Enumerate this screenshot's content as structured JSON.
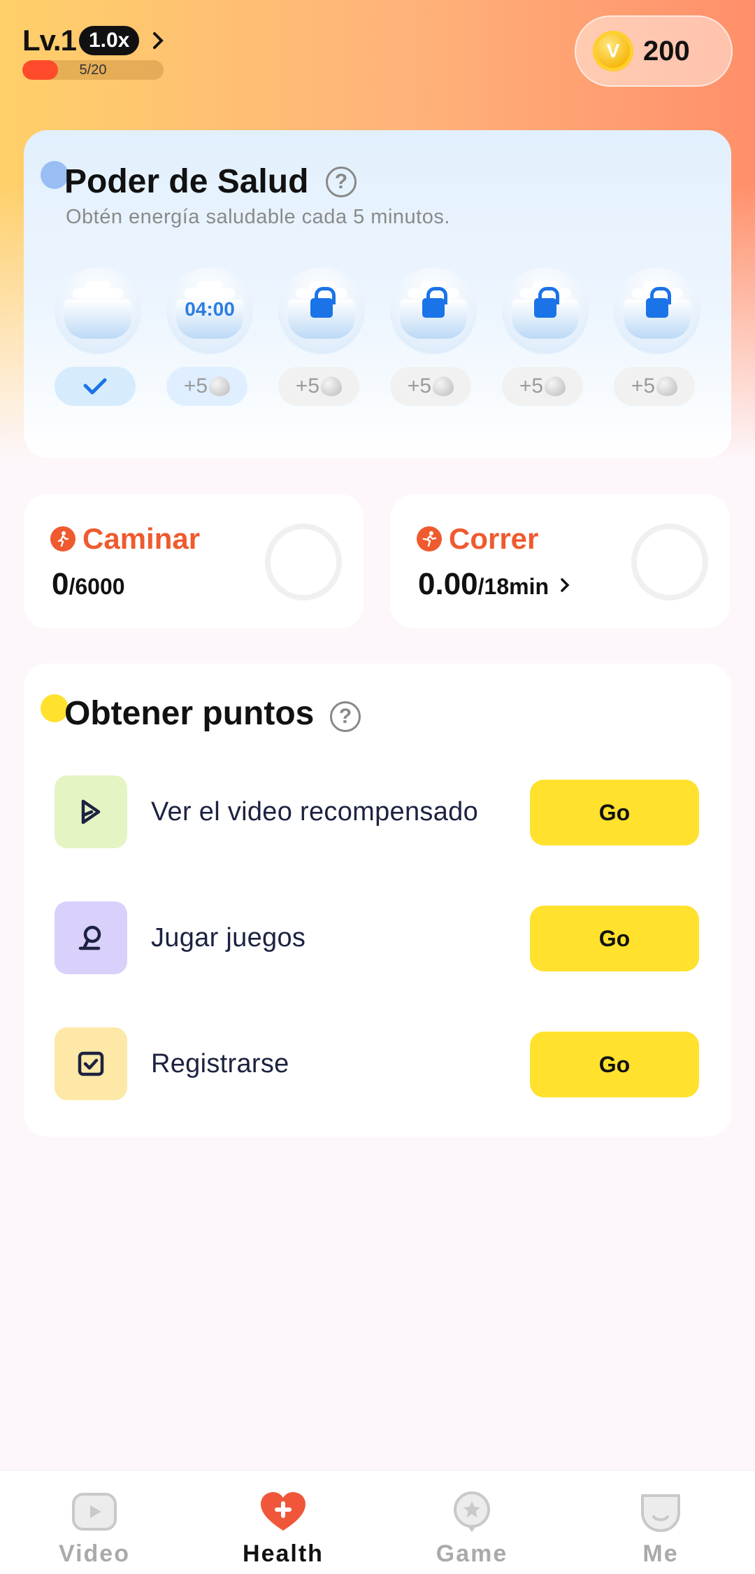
{
  "header": {
    "level": "Lv.1",
    "multiplier": "1.0x",
    "progress_text": "5/20",
    "progress_fraction": 0.25,
    "coins": "200",
    "coin_symbol": "V"
  },
  "health_power": {
    "title": "Poder de Salud",
    "help": "?",
    "subtitle": "Obtén energía saludable cada 5 minutos.",
    "slots": [
      {
        "state": "claimed",
        "icon": "check-icon"
      },
      {
        "state": "timer",
        "timer": "04:00",
        "reward": "+5"
      },
      {
        "state": "locked",
        "reward": "+5"
      },
      {
        "state": "locked",
        "reward": "+5"
      },
      {
        "state": "locked",
        "reward": "+5"
      },
      {
        "state": "locked",
        "reward": "+5"
      }
    ]
  },
  "walk": {
    "label": "Caminar",
    "value": "0",
    "target": "/6000"
  },
  "run": {
    "label": "Correr",
    "value": "0.00",
    "target": "/18min"
  },
  "points": {
    "title": "Obtener puntos",
    "help": "?",
    "tasks": [
      {
        "label": "Ver el video recompensado",
        "button": "Go"
      },
      {
        "label": "Jugar juegos",
        "button": "Go"
      },
      {
        "label": "Registrarse",
        "button": "Go"
      }
    ]
  },
  "nav": {
    "items": [
      {
        "label": "Video",
        "icon": "video-icon"
      },
      {
        "label": "Health",
        "icon": "health-icon",
        "active": true
      },
      {
        "label": "Game",
        "icon": "game-icon"
      },
      {
        "label": "Me",
        "icon": "me-icon"
      }
    ]
  },
  "colors": {
    "accent_orange": "#ef5a2e",
    "button_yellow": "#ffe12e",
    "lock_blue": "#1b73e8"
  }
}
